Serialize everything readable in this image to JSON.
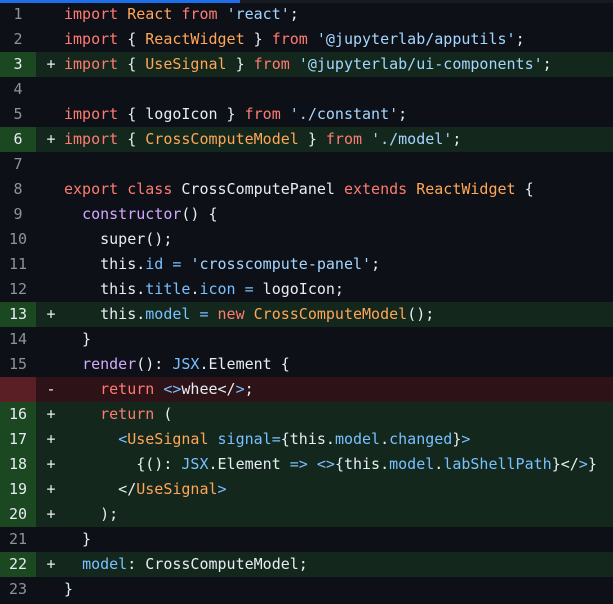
{
  "colors": {
    "background": "#0d1117",
    "added_row": "#13271c",
    "added_gutter": "#1b4721",
    "removed_row": "#2d1318",
    "removed_gutter": "#5a1e25",
    "keyword": "#ff7b72",
    "class_name": "#ffa657",
    "string": "#a5d6ff",
    "function": "#d2a8ff",
    "property": "#79c0ff",
    "tag": "#7ee787"
  },
  "diff": {
    "lines": [
      {
        "num": "1",
        "type": "ctx",
        "marker": "",
        "tokens": [
          [
            "kw",
            "import"
          ],
          [
            "txt",
            " "
          ],
          [
            "cls",
            "React"
          ],
          [
            "txt",
            " "
          ],
          [
            "kw",
            "from"
          ],
          [
            "txt",
            " "
          ],
          [
            "str",
            "'react'"
          ],
          [
            "txt",
            ";"
          ]
        ]
      },
      {
        "num": "2",
        "type": "ctx",
        "marker": "",
        "tokens": [
          [
            "kw",
            "import"
          ],
          [
            "txt",
            " { "
          ],
          [
            "cls",
            "ReactWidget"
          ],
          [
            "txt",
            " } "
          ],
          [
            "kw",
            "from"
          ],
          [
            "txt",
            " "
          ],
          [
            "str",
            "'@jupyterlab/apputils'"
          ],
          [
            "txt",
            ";"
          ]
        ]
      },
      {
        "num": "3",
        "type": "add",
        "marker": "+",
        "tokens": [
          [
            "kw",
            "import"
          ],
          [
            "txt",
            " { "
          ],
          [
            "cls",
            "UseSignal"
          ],
          [
            "txt",
            " } "
          ],
          [
            "kw",
            "from"
          ],
          [
            "txt",
            " "
          ],
          [
            "str",
            "'@jupyterlab/ui-components'"
          ],
          [
            "txt",
            ";"
          ]
        ]
      },
      {
        "num": "4",
        "type": "ctx",
        "marker": "",
        "tokens": []
      },
      {
        "num": "5",
        "type": "ctx",
        "marker": "",
        "tokens": [
          [
            "kw",
            "import"
          ],
          [
            "txt",
            " { logoIcon } "
          ],
          [
            "kw",
            "from"
          ],
          [
            "txt",
            " "
          ],
          [
            "str",
            "'./constant'"
          ],
          [
            "txt",
            ";"
          ]
        ]
      },
      {
        "num": "6",
        "type": "add",
        "marker": "+",
        "tokens": [
          [
            "kw",
            "import"
          ],
          [
            "txt",
            " { "
          ],
          [
            "cls",
            "CrossComputeModel"
          ],
          [
            "txt",
            " } "
          ],
          [
            "kw",
            "from"
          ],
          [
            "txt",
            " "
          ],
          [
            "str",
            "'./model'"
          ],
          [
            "txt",
            ";"
          ]
        ]
      },
      {
        "num": "7",
        "type": "ctx",
        "marker": "",
        "tokens": []
      },
      {
        "num": "8",
        "type": "ctx",
        "marker": "",
        "tokens": [
          [
            "kw",
            "export"
          ],
          [
            "txt",
            " "
          ],
          [
            "kw",
            "class"
          ],
          [
            "txt",
            " CrossComputePanel "
          ],
          [
            "kw",
            "extends"
          ],
          [
            "txt",
            " "
          ],
          [
            "cls",
            "ReactWidget"
          ],
          [
            "txt",
            " {"
          ]
        ]
      },
      {
        "num": "9",
        "type": "ctx",
        "marker": "",
        "tokens": [
          [
            "txt",
            "  "
          ],
          [
            "fn",
            "constructor"
          ],
          [
            "txt",
            "() {"
          ]
        ]
      },
      {
        "num": "10",
        "type": "ctx",
        "marker": "",
        "tokens": [
          [
            "txt",
            "    super();"
          ]
        ]
      },
      {
        "num": "11",
        "type": "ctx",
        "marker": "",
        "tokens": [
          [
            "txt",
            "    this."
          ],
          [
            "prop",
            "id"
          ],
          [
            "txt",
            " "
          ],
          [
            "op",
            "="
          ],
          [
            "txt",
            " "
          ],
          [
            "str",
            "'crosscompute-panel'"
          ],
          [
            "txt",
            ";"
          ]
        ]
      },
      {
        "num": "12",
        "type": "ctx",
        "marker": "",
        "tokens": [
          [
            "txt",
            "    this."
          ],
          [
            "prop",
            "title"
          ],
          [
            "txt",
            "."
          ],
          [
            "prop",
            "icon"
          ],
          [
            "txt",
            " "
          ],
          [
            "op",
            "="
          ],
          [
            "txt",
            " logoIcon;"
          ]
        ]
      },
      {
        "num": "13",
        "type": "add",
        "marker": "+",
        "tokens": [
          [
            "txt",
            "    this."
          ],
          [
            "prop",
            "model"
          ],
          [
            "txt",
            " "
          ],
          [
            "op",
            "="
          ],
          [
            "txt",
            " "
          ],
          [
            "kw",
            "new"
          ],
          [
            "txt",
            " "
          ],
          [
            "cls",
            "CrossComputeModel"
          ],
          [
            "txt",
            "();"
          ]
        ]
      },
      {
        "num": "14",
        "type": "ctx",
        "marker": "",
        "tokens": [
          [
            "txt",
            "  }"
          ]
        ]
      },
      {
        "num": "15",
        "type": "ctx",
        "marker": "",
        "tokens": [
          [
            "txt",
            "  "
          ],
          [
            "fn",
            "render"
          ],
          [
            "txt",
            "(): "
          ],
          [
            "prop",
            "JSX"
          ],
          [
            "txt",
            ".Element {"
          ]
        ]
      },
      {
        "num": "",
        "type": "del",
        "marker": "-",
        "tokens": [
          [
            "txt",
            "    "
          ],
          [
            "kw",
            "return"
          ],
          [
            "txt",
            " "
          ],
          [
            "op",
            "<>"
          ],
          [
            "txt",
            "whee</"
          ],
          [
            "op",
            ">"
          ],
          [
            "txt",
            ";"
          ]
        ]
      },
      {
        "num": "16",
        "type": "add",
        "marker": "+",
        "tokens": [
          [
            "txt",
            "    "
          ],
          [
            "kw",
            "return"
          ],
          [
            "txt",
            " ("
          ]
        ]
      },
      {
        "num": "17",
        "type": "add",
        "marker": "+",
        "tokens": [
          [
            "txt",
            "      "
          ],
          [
            "op",
            "<"
          ],
          [
            "cls",
            "UseSignal"
          ],
          [
            "txt",
            " "
          ],
          [
            "prop",
            "signal"
          ],
          [
            "op",
            "="
          ],
          [
            "txt",
            "{this."
          ],
          [
            "prop",
            "model"
          ],
          [
            "txt",
            "."
          ],
          [
            "prop",
            "changed"
          ],
          [
            "txt",
            "}"
          ],
          [
            "op",
            ">"
          ]
        ]
      },
      {
        "num": "18",
        "type": "add",
        "marker": "+",
        "tokens": [
          [
            "txt",
            "        {(): "
          ],
          [
            "prop",
            "JSX"
          ],
          [
            "txt",
            ".Element "
          ],
          [
            "op",
            "=>"
          ],
          [
            "txt",
            " "
          ],
          [
            "op",
            "<>"
          ],
          [
            "txt",
            "{this."
          ],
          [
            "prop",
            "model"
          ],
          [
            "txt",
            "."
          ],
          [
            "prop",
            "labShellPath"
          ],
          [
            "txt",
            "}</"
          ],
          [
            "op",
            ">"
          ],
          [
            "txt",
            "}"
          ]
        ]
      },
      {
        "num": "19",
        "type": "add",
        "marker": "+",
        "tokens": [
          [
            "txt",
            "      </"
          ],
          [
            "cls",
            "UseSignal"
          ],
          [
            "op",
            ">"
          ]
        ]
      },
      {
        "num": "20",
        "type": "add",
        "marker": "+",
        "tokens": [
          [
            "txt",
            "    );"
          ]
        ]
      },
      {
        "num": "21",
        "type": "ctx",
        "marker": "",
        "tokens": [
          [
            "txt",
            "  }"
          ]
        ]
      },
      {
        "num": "22",
        "type": "add",
        "marker": "+",
        "tokens": [
          [
            "txt",
            "  "
          ],
          [
            "prop",
            "model"
          ],
          [
            "txt",
            ": CrossComputeModel;"
          ]
        ]
      },
      {
        "num": "23",
        "type": "ctx",
        "marker": "",
        "tokens": [
          [
            "txt",
            "}"
          ]
        ]
      }
    ]
  }
}
